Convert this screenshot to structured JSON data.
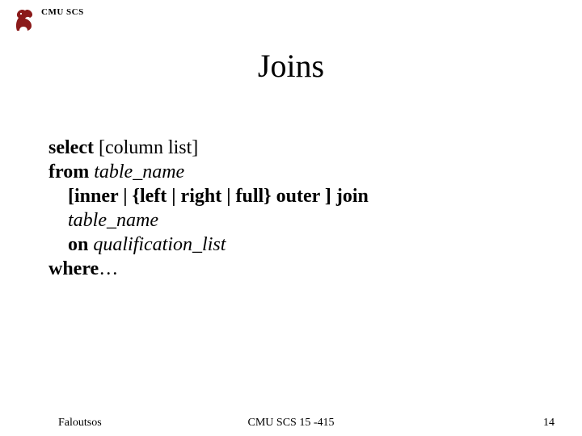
{
  "header": {
    "org": "CMU SCS",
    "icon": "cmu-scs-dragon-icon"
  },
  "title": "Joins",
  "syntax": {
    "line1_kw": "select",
    "line1_rest": " [column list]",
    "line2_kw": "from",
    "line2_rest": "  table_name",
    "line3": "[inner | {left | right | full} outer ] join",
    "line4": "table_name",
    "line5_kw": "on",
    "line5_rest": " qualification_list",
    "line6_kw": "where",
    "line6_rest": "…"
  },
  "footer": {
    "author": "Faloutsos",
    "course": "CMU SCS 15 -415",
    "page": "14"
  }
}
